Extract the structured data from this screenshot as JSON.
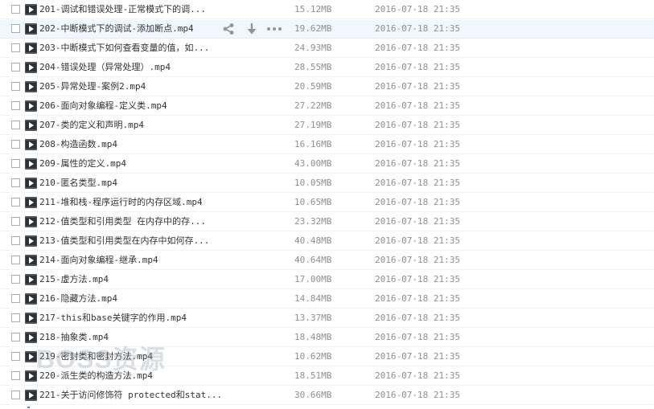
{
  "files": [
    {
      "name": "201-调试和错误处理-正常模式下的调...",
      "size": "15.12MB",
      "date": "2016-07-18 21:35"
    },
    {
      "name": "202-中断模式下的调试-添加断点.mp4",
      "size": "19.62MB",
      "date": "2016-07-18 21:35"
    },
    {
      "name": "203-中断模式下如何查看变量的值，如...",
      "size": "24.93MB",
      "date": "2016-07-18 21:35"
    },
    {
      "name": "204-错误处理（异常处理）.mp4",
      "size": "28.55MB",
      "date": "2016-07-18 21:35"
    },
    {
      "name": "205-异常处理-案例2.mp4",
      "size": "20.59MB",
      "date": "2016-07-18 21:35"
    },
    {
      "name": "206-面向对象编程-定义类.mp4",
      "size": "27.22MB",
      "date": "2016-07-18 21:35"
    },
    {
      "name": "207-类的定义和声明.mp4",
      "size": "27.19MB",
      "date": "2016-07-18 21:35"
    },
    {
      "name": "208-构造函数.mp4",
      "size": "16.16MB",
      "date": "2016-07-18 21:35"
    },
    {
      "name": "209-属性的定义.mp4",
      "size": "43.00MB",
      "date": "2016-07-18 21:35"
    },
    {
      "name": "210-匿名类型.mp4",
      "size": "10.05MB",
      "date": "2016-07-18 21:35"
    },
    {
      "name": "211-堆和栈-程序运行时的内存区域.mp4",
      "size": "10.65MB",
      "date": "2016-07-18 21:35"
    },
    {
      "name": "212-值类型和引用类型 在内存中的存...",
      "size": "23.32MB",
      "date": "2016-07-18 21:35"
    },
    {
      "name": "213-值类型和引用类型在内存中如何存...",
      "size": "40.48MB",
      "date": "2016-07-18 21:35"
    },
    {
      "name": "214-面向对象编程-继承.mp4",
      "size": "40.64MB",
      "date": "2016-07-18 21:35"
    },
    {
      "name": "215-虚方法.mp4",
      "size": "17.00MB",
      "date": "2016-07-18 21:35"
    },
    {
      "name": "216-隐藏方法.mp4",
      "size": "14.84MB",
      "date": "2016-07-18 21:35"
    },
    {
      "name": "217-this和base关键字的作用.mp4",
      "size": "13.37MB",
      "date": "2016-07-18 21:35"
    },
    {
      "name": "218-抽象类.mp4",
      "size": "18.48MB",
      "date": "2016-07-18 21:35"
    },
    {
      "name": "219-密封类和密封方法.mp4",
      "size": "10.62MB",
      "date": "2016-07-18 21:35"
    },
    {
      "name": "220-派生类的构造方法.mp4",
      "size": "18.51MB",
      "date": "2016-07-18 21:35"
    },
    {
      "name": "221-关于访问修饰符 protected和stat...",
      "size": "30.66MB",
      "date": "2016-07-18 21:35"
    }
  ],
  "hovered_index": 1,
  "row_actions": {
    "share": "share-icon",
    "download": "download-icon",
    "more": "more-icon"
  },
  "watermark": "BOSS资源",
  "colors": {
    "hover_row": "#f2f7fe",
    "action_icon": "#8a96a8",
    "text": "#333333",
    "meta_text": "#8f8f8f"
  }
}
